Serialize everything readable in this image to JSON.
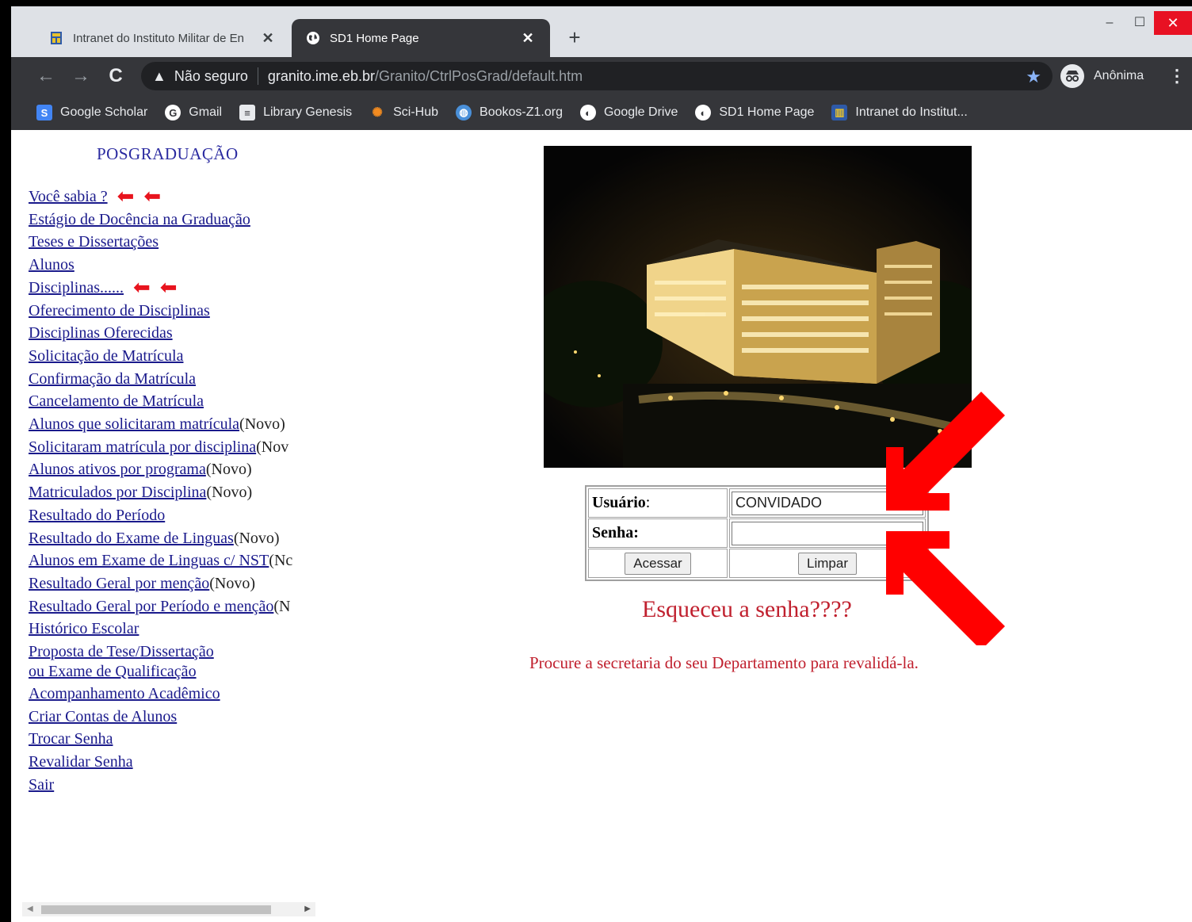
{
  "browser": {
    "tabs": [
      {
        "title": "Intranet do Instituto Militar de En",
        "active": false
      },
      {
        "title": "SD1 Home Page",
        "active": true
      }
    ],
    "new_tab_label": "+",
    "window_controls": {
      "minimize": "–",
      "maximize": "☐",
      "close": "✕"
    },
    "address": {
      "security_label": "Não seguro",
      "host": "granito.ime.eb.br",
      "path": "/Granito/CtrlPosGrad/default.htm"
    },
    "profile_label": "Anônima",
    "bookmarks": [
      {
        "label": "Google Scholar",
        "icon": "google-scholar-icon"
      },
      {
        "label": "Gmail",
        "icon": "google-icon"
      },
      {
        "label": "Library Genesis",
        "icon": "book-icon"
      },
      {
        "label": "Sci-Hub",
        "icon": "sci-hub-icon"
      },
      {
        "label": "Bookos-Z1.org",
        "icon": "globe-blue-icon"
      },
      {
        "label": "Google Drive",
        "icon": "globe-icon"
      },
      {
        "label": "SD1 Home Page",
        "icon": "globe-icon"
      },
      {
        "label": "Intranet do Institut...",
        "icon": "ime-logo-icon"
      }
    ]
  },
  "sidebar": {
    "title": "POSGRADUAÇÃO",
    "links": [
      {
        "label": "Você sabia ?",
        "suffix": "",
        "arrows": true
      },
      {
        "label": "Estágio de Docência na Graduação",
        "suffix": ""
      },
      {
        "label": "Teses e Dissertações",
        "suffix": ""
      },
      {
        "label": "Alunos",
        "suffix": ""
      },
      {
        "label": "Disciplinas......",
        "suffix": "",
        "arrows": true
      },
      {
        "label": "Oferecimento de Disciplinas",
        "suffix": ""
      },
      {
        "label": "Disciplinas Oferecidas",
        "suffix": ""
      },
      {
        "label": "Solicitação de Matrícula",
        "suffix": ""
      },
      {
        "label": "Confirmação da Matrícula",
        "suffix": ""
      },
      {
        "label": "Cancelamento de Matrícula",
        "suffix": ""
      },
      {
        "label": "Alunos que solicitaram matrícula",
        "suffix": "(Novo)"
      },
      {
        "label": "Solicitaram matrícula por disciplina",
        "suffix": "(Nov"
      },
      {
        "label": "Alunos ativos por programa",
        "suffix": "(Novo)"
      },
      {
        "label": "Matriculados por Disciplina",
        "suffix": "(Novo)"
      },
      {
        "label": "Resultado do Período",
        "suffix": ""
      },
      {
        "label": "Resultado do Exame de Linguas",
        "suffix": "(Novo)"
      },
      {
        "label": "Alunos em Exame de Linguas c/ NST",
        "suffix": "(Nc"
      },
      {
        "label": "Resultado Geral por menção",
        "suffix": "(Novo)"
      },
      {
        "label": "Resultado Geral por Período e menção",
        "suffix": "(N"
      },
      {
        "label": "Histórico Escolar",
        "suffix": ""
      },
      {
        "label": "Proposta de Tese/Dissertação",
        "suffix": ""
      },
      {
        "label": "ou Exame de Qualificação",
        "suffix": ""
      },
      {
        "label": "Acompanhamento Acadêmico",
        "suffix": ""
      },
      {
        "label": "Criar Contas de Alunos",
        "suffix": ""
      },
      {
        "label": "Trocar Senha",
        "suffix": ""
      },
      {
        "label": "Revalidar Senha",
        "suffix": ""
      },
      {
        "label": "Sair",
        "suffix": ""
      }
    ]
  },
  "login": {
    "user_label": "Usuário",
    "user_colon": " :",
    "user_value": "CONVIDADO",
    "password_label": "Senha:",
    "password_value": "",
    "submit_label": "Acessar",
    "reset_label": "Limpar"
  },
  "forgot": {
    "headline": "Esqueceu a senha????",
    "instruction": "Procure a secretaria do seu Departamento para revalidá-la."
  },
  "colors": {
    "link": "#1a1a8c",
    "title": "#2a2aa0",
    "alert_text": "#c0202e",
    "annotation_arrow": "#ff0000",
    "chrome_dark": "#35363a"
  }
}
